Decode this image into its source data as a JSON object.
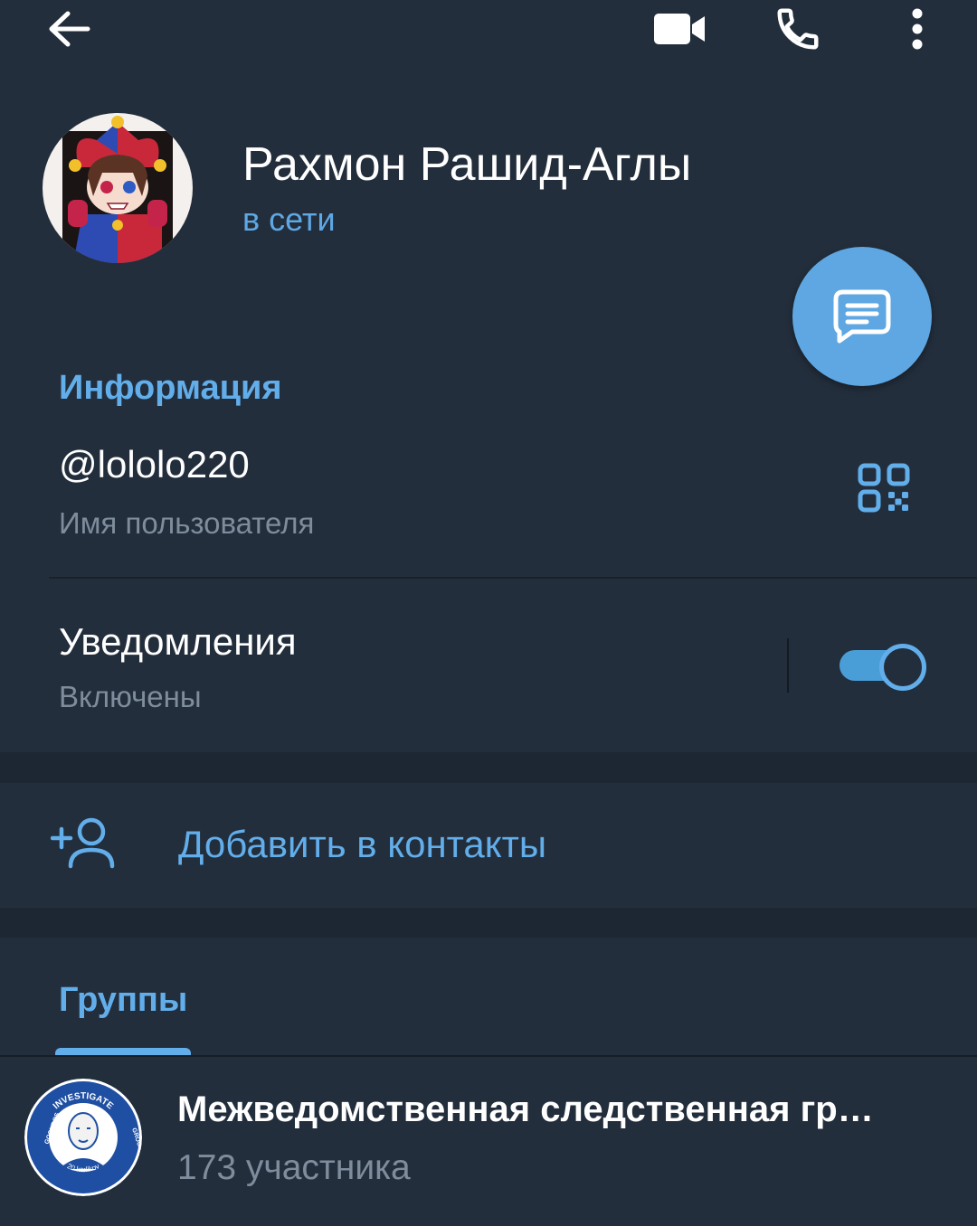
{
  "toolbar": {
    "back_icon": "arrow-left-icon",
    "video_icon": "video-camera-icon",
    "call_icon": "phone-icon",
    "more_icon": "more-vertical-icon"
  },
  "profile": {
    "name": "Рахмон Рашид-Аглы",
    "status": "в сети",
    "avatar": "anime-jester-character-avatar"
  },
  "fab": {
    "icon": "message-icon"
  },
  "info": {
    "title": "Информация",
    "username": "@lololo220",
    "username_caption": "Имя пользователя",
    "qr_icon": "qr-code-icon",
    "notifications_label": "Уведомления",
    "notifications_state": "Включены",
    "notifications_enabled": true
  },
  "add_contact": {
    "label": "Добавить в контакты",
    "icon": "add-user-icon"
  },
  "groups": {
    "tab_label": "Группы",
    "items": [
      {
        "name": "Межведомственная следственная гр…",
        "members": "173 участника",
        "logo_text_top": "INVESTIGATE",
        "logo_text_left": "GOONDOS",
        "logo_text_right": "GROUP",
        "logo_text_bottom": "20 karlikov"
      }
    ]
  },
  "colors": {
    "background": "#1d2733",
    "panel": "#232e3c",
    "accent": "#62aeeb",
    "secondary_text": "#7e8c9b",
    "fab": "#5ea7e2"
  }
}
